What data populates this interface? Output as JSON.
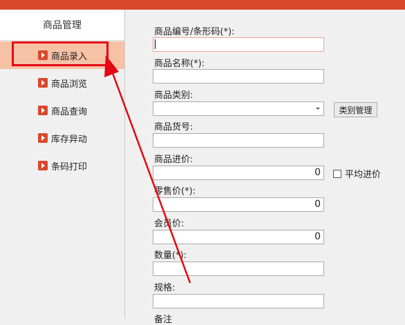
{
  "sidebar": {
    "header": "商品管理",
    "items": [
      {
        "label": "商品录入"
      },
      {
        "label": "商品浏览"
      },
      {
        "label": "商品查询"
      },
      {
        "label": "库存异动"
      },
      {
        "label": "条码打印"
      }
    ]
  },
  "form": {
    "barcode": {
      "label": "商品编号/条形码(*):",
      "value": ""
    },
    "name": {
      "label": "商品名称(*):",
      "value": ""
    },
    "category": {
      "label": "商品类别:",
      "value": "",
      "button": "类别管理"
    },
    "item_no": {
      "label": "商品货号:",
      "value": ""
    },
    "purchase_price": {
      "label": "商品进价:",
      "value": "0",
      "checkbox_label": "平均进价",
      "checked": false
    },
    "retail_price": {
      "label": "零售价(*):",
      "value": "0"
    },
    "member_price": {
      "label": "会员价:",
      "value": "0"
    },
    "quantity": {
      "label": "数量(*):",
      "value": ""
    },
    "spec": {
      "label": "规格:",
      "value": ""
    },
    "remark": {
      "label": "备注"
    }
  },
  "colors": {
    "accent": "#d9482b",
    "highlight_box": "#e30613",
    "active_item": "#f7c1a6"
  }
}
